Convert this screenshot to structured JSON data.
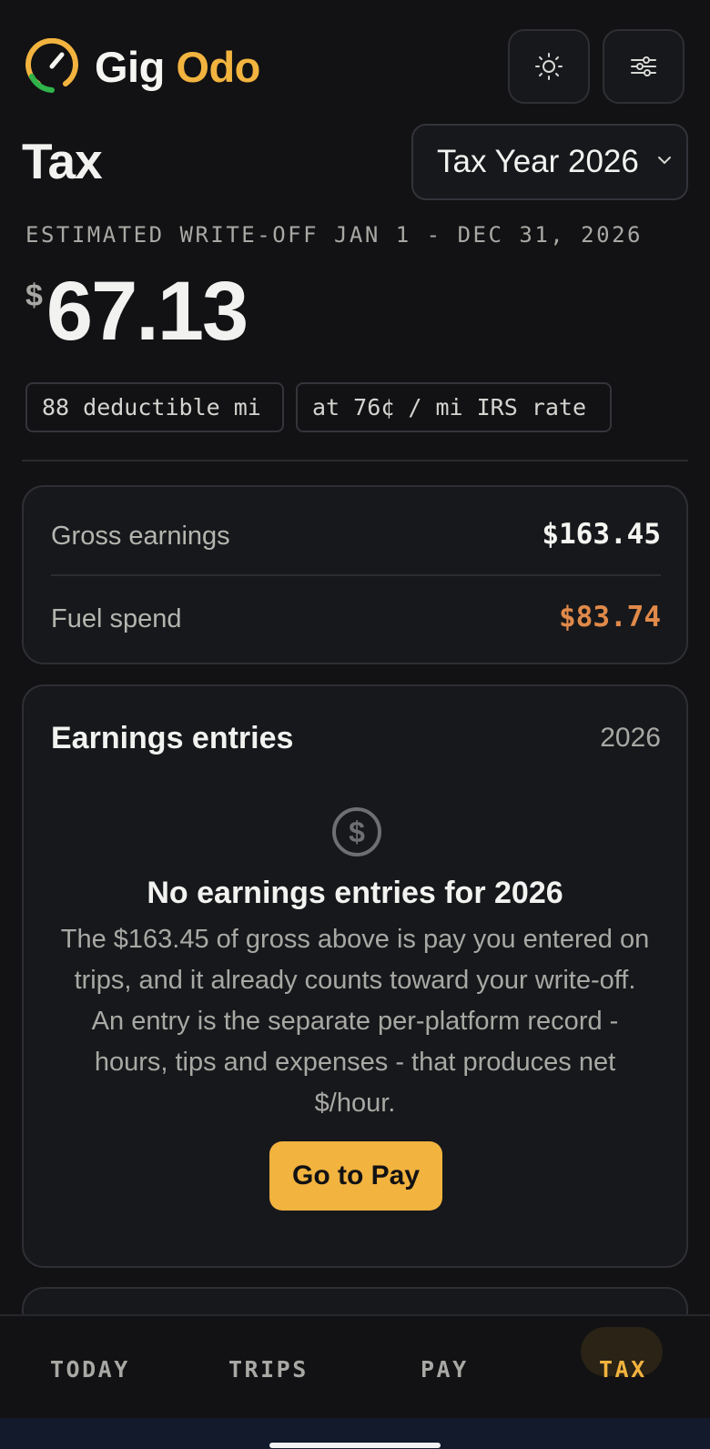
{
  "app": {
    "brand_part1": "Gig",
    "brand_part2": "Odo"
  },
  "header": {
    "title": "Tax",
    "year_select": "Tax Year 2026"
  },
  "estimate": {
    "label": "ESTIMATED WRITE-OFF JAN 1 - DEC 31, 2026",
    "currency": "$",
    "amount": "67.13",
    "chips": [
      "88 deductible mi",
      "at 76¢ / mi IRS rate"
    ]
  },
  "summary": {
    "gross_label": "Gross earnings",
    "gross_value": "$163.45",
    "fuel_label": "Fuel spend",
    "fuel_value": "$83.74"
  },
  "entries": {
    "title": "Earnings entries",
    "year": "2026",
    "empty_title": "No earnings entries for 2026",
    "empty_desc": "The $163.45 of gross above is pay you entered on trips, and it already counts toward your write-off. An entry is the separate per-platform record - hours, tips and expenses - that produces net $/hour.",
    "button": "Go to Pay"
  },
  "nav": {
    "today": "TODAY",
    "trips": "TRIPS",
    "pay": "PAY",
    "tax": "TAX",
    "active": "tax"
  },
  "colors": {
    "accent": "#f2b33f",
    "fuel": "#e08a4a",
    "background": "#121214",
    "card": "#17181b",
    "logo_green": "#2fb34a"
  },
  "icons": [
    "gauge-logo-icon",
    "sun-icon",
    "sliders-icon",
    "chevron-down-icon",
    "dollar-circle-icon"
  ]
}
